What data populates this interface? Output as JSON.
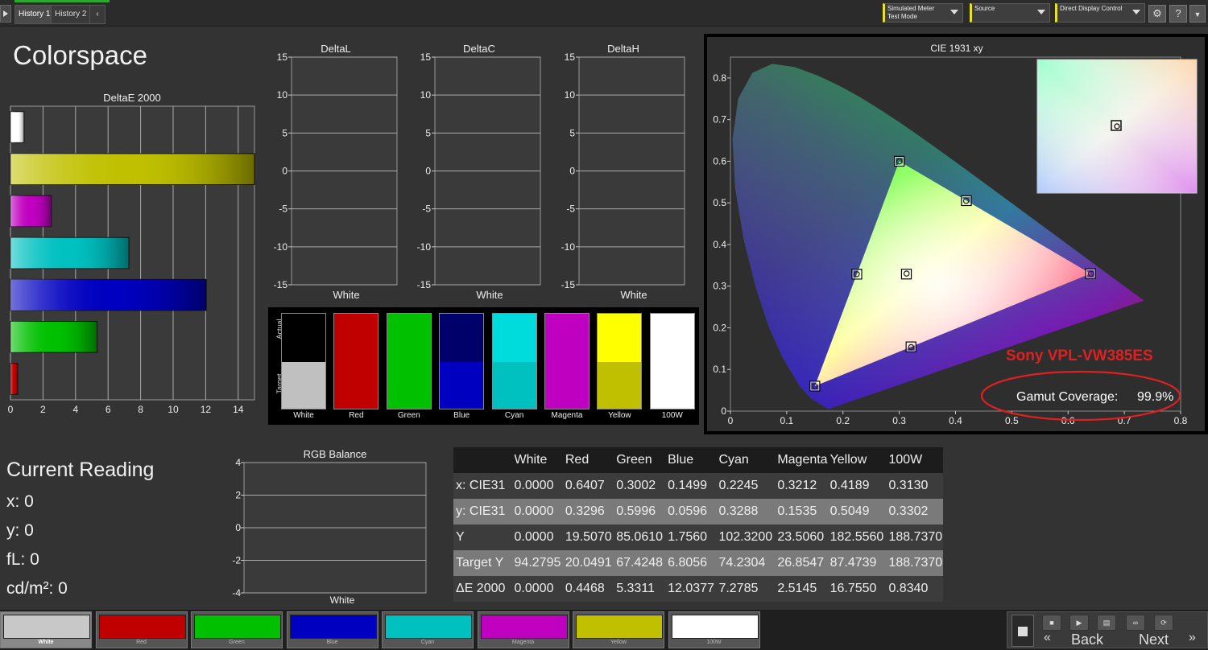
{
  "topbar": {
    "tabs": [
      "History 1",
      "History 2"
    ],
    "meter_line1": "Simulated Meter",
    "meter_line2": "Test Mode",
    "source": "Source",
    "direct_display": "Direct Display Control",
    "help": "?"
  },
  "page_title": "Colorspace",
  "colors": {
    "White": "#ffffff",
    "Red": "#c00000",
    "Green": "#00c000",
    "Blue": "#0000c0",
    "Cyan": "#00c0c0",
    "Magenta": "#c000c0",
    "Yellow": "#c0c000",
    "100W": "#ffffff"
  },
  "deltae_chart": {
    "title": "DeltaE 2000",
    "type": "bar",
    "orientation": "horizontal",
    "categories": [
      "White",
      "Yellow",
      "Magenta",
      "Cyan",
      "Blue",
      "Green",
      "Red"
    ],
    "values": [
      0.834,
      16.755,
      2.5145,
      7.2785,
      12.0377,
      5.3311,
      0.4468
    ],
    "bar_colors": [
      "#ffffff",
      "#c0c000",
      "#c000c0",
      "#00c0c0",
      "#0000c0",
      "#00c000",
      "#c00000"
    ],
    "xlim": [
      0,
      15
    ],
    "xticks": [
      "0",
      "2",
      "4",
      "6",
      "8",
      "10",
      "12",
      "14"
    ]
  },
  "delta_charts": [
    {
      "title": "DeltaL",
      "xlabel": "White"
    },
    {
      "title": "DeltaC",
      "xlabel": "White"
    },
    {
      "title": "DeltaH",
      "xlabel": "White"
    }
  ],
  "delta_yticks": [
    "15",
    "10",
    "5",
    "0",
    "-5",
    "-10",
    "-15"
  ],
  "swatch_panel": {
    "actual_label": "Actual",
    "target_label": "Target",
    "items": [
      {
        "name": "White",
        "actual": "#000000",
        "target": "#c0c0c0"
      },
      {
        "name": "Red",
        "actual": "#c00000",
        "target": "#c00000"
      },
      {
        "name": "Green",
        "actual": "#00c000",
        "target": "#00c000"
      },
      {
        "name": "Blue",
        "actual": "#00006a",
        "target": "#0000c0"
      },
      {
        "name": "Cyan",
        "actual": "#00dcdc",
        "target": "#00c0c0"
      },
      {
        "name": "Magenta",
        "actual": "#c000c0",
        "target": "#c000c0"
      },
      {
        "name": "Yellow",
        "actual": "#ffff00",
        "target": "#c0c000"
      },
      {
        "name": "100W",
        "actual": "#ffffff",
        "target": "#ffffff"
      }
    ]
  },
  "cie_chart": {
    "title": "CIE 1931 xy",
    "type": "scatter",
    "xlim": [
      0,
      0.8
    ],
    "ylim": [
      0,
      0.85
    ],
    "xticks": [
      "0",
      "0.1",
      "0.2",
      "0.3",
      "0.4",
      "0.5",
      "0.6",
      "0.7",
      "0.8"
    ],
    "yticks": [
      "0",
      "0.1",
      "0.2",
      "0.3",
      "0.4",
      "0.5",
      "0.6",
      "0.7",
      "0.8"
    ],
    "gamut": {
      "red": [
        0.64,
        0.33
      ],
      "green": [
        0.3,
        0.6
      ],
      "blue": [
        0.15,
        0.06
      ]
    },
    "targets": [
      {
        "name": "Red",
        "x": 0.64,
        "y": 0.33
      },
      {
        "name": "Green",
        "x": 0.3,
        "y": 0.6
      },
      {
        "name": "Blue",
        "x": 0.15,
        "y": 0.06
      },
      {
        "name": "Cyan",
        "x": 0.2246,
        "y": 0.3287
      },
      {
        "name": "Magenta",
        "x": 0.3209,
        "y": 0.1542
      },
      {
        "name": "Yellow",
        "x": 0.4193,
        "y": 0.5053
      },
      {
        "name": "White",
        "x": 0.3127,
        "y": 0.329
      }
    ],
    "measured": [
      {
        "name": "Red",
        "x": 0.6407,
        "y": 0.3296
      },
      {
        "name": "Green",
        "x": 0.3002,
        "y": 0.5996
      },
      {
        "name": "Blue",
        "x": 0.1499,
        "y": 0.0596
      },
      {
        "name": "Cyan",
        "x": 0.2245,
        "y": 0.3288
      },
      {
        "name": "Magenta",
        "x": 0.3212,
        "y": 0.1535
      },
      {
        "name": "Yellow",
        "x": 0.4189,
        "y": 0.5049
      },
      {
        "name": "100W",
        "x": 0.313,
        "y": 0.3302
      }
    ],
    "annotation_model": "Sony VPL-VW385ES",
    "annotation_coverage_label": "Gamut Coverage:",
    "annotation_coverage_value": "99.9%",
    "annotation_color": "#e02020"
  },
  "current_reading": {
    "title": "Current Reading",
    "x": "x: 0",
    "y": "y: 0",
    "fl": "fL: 0",
    "cdm2": "cd/m²: 0"
  },
  "rgb_balance": {
    "title": "RGB Balance",
    "xlabel": "White",
    "yticks": [
      "4",
      "2",
      "0",
      "-2",
      "-4"
    ]
  },
  "readings_table": {
    "headers": [
      "",
      "White",
      "Red",
      "Green",
      "Blue",
      "Cyan",
      "Magenta",
      "Yellow",
      "100W"
    ],
    "rows": [
      [
        "x: CIE31",
        "0.0000",
        "0.6407",
        "0.3002",
        "0.1499",
        "0.2245",
        "0.3212",
        "0.4189",
        "0.3130"
      ],
      [
        "y: CIE31",
        "0.0000",
        "0.3296",
        "0.5996",
        "0.0596",
        "0.3288",
        "0.1535",
        "0.5049",
        "0.3302"
      ],
      [
        "Y",
        "0.0000",
        "19.5070",
        "85.0610",
        "1.7560",
        "102.3200",
        "23.5060",
        "182.5560",
        "188.7370"
      ],
      [
        "Target Y",
        "94.2795",
        "20.0491",
        "67.4248",
        "6.8056",
        "74.2304",
        "26.8547",
        "87.4739",
        "188.7370"
      ],
      [
        "ΔE 2000",
        "0.0000",
        "0.4468",
        "5.3311",
        "12.0377",
        "7.2785",
        "2.5145",
        "16.7550",
        "0.8340"
      ]
    ]
  },
  "bottom_swatches": [
    {
      "label": "White",
      "color": "#c8c8c8"
    },
    {
      "label": "Red",
      "color": "#c00000"
    },
    {
      "label": "Green",
      "color": "#00c000"
    },
    {
      "label": "Blue",
      "color": "#0000c0"
    },
    {
      "label": "Cyan",
      "color": "#00c0c0"
    },
    {
      "label": "Magenta",
      "color": "#c000c0"
    },
    {
      "label": "Yellow",
      "color": "#c0c000"
    },
    {
      "label": "100W",
      "color": "#ffffff"
    }
  ],
  "nav": {
    "back": "Back",
    "next": "Next"
  }
}
